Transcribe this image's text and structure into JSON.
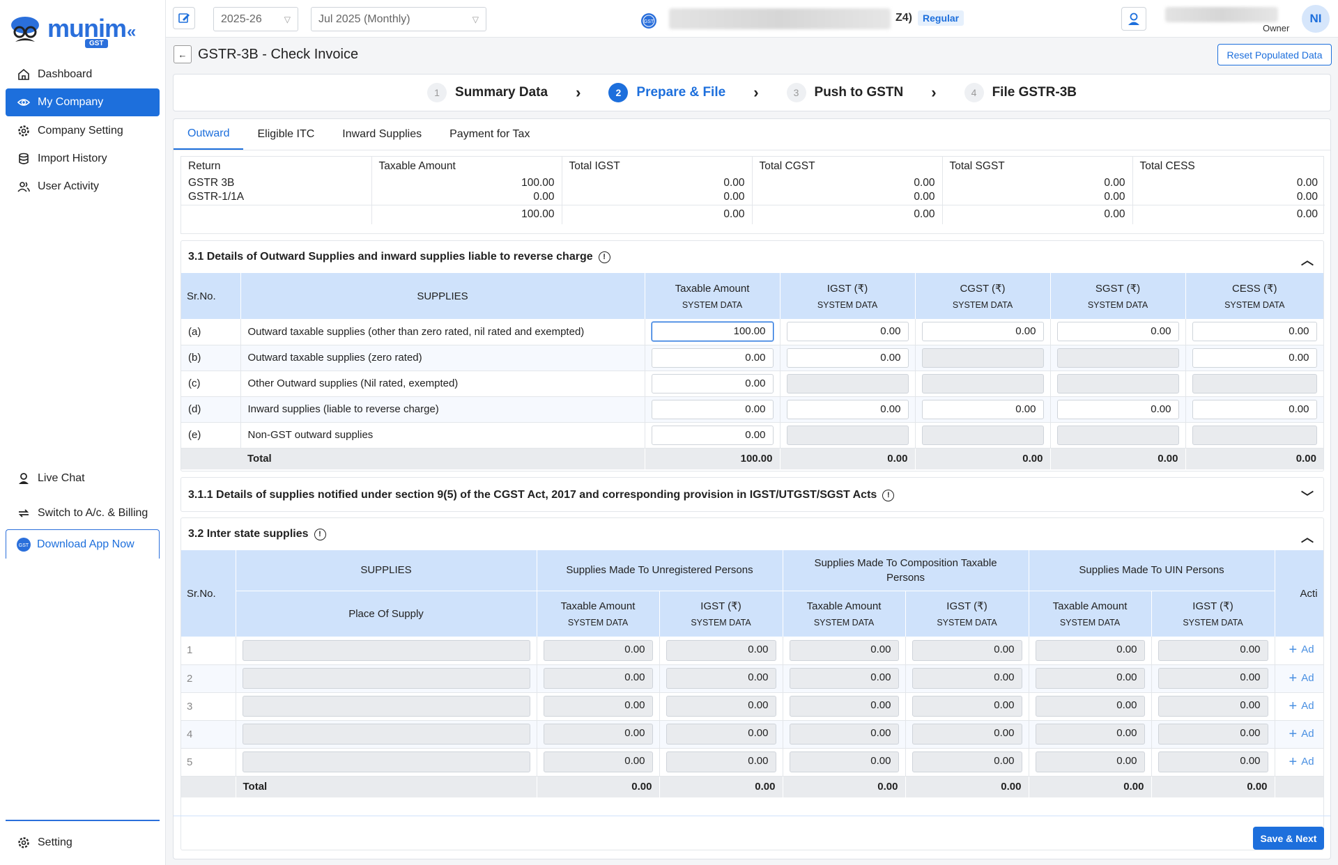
{
  "app": {
    "logo": "munim",
    "logo_sub": "GST",
    "collapse": "«"
  },
  "sidebar": {
    "items": [
      {
        "label": "Dashboard"
      },
      {
        "label": "My Company"
      },
      {
        "label": "Company Setting"
      },
      {
        "label": "Import History"
      },
      {
        "label": "User Activity"
      }
    ],
    "bottom": {
      "live_chat": "Live Chat",
      "switch": "Switch to A/c. & Billing",
      "download": "Download App Now",
      "setting": "Setting"
    }
  },
  "topbar": {
    "year": "2025-26",
    "period": "Jul 2025 (Monthly)",
    "gstin_suffix": "Z4)",
    "type_badge": "Regular",
    "role": "Owner",
    "avatar": "NI"
  },
  "page": {
    "back": "←",
    "title": "GSTR-3B - Check Invoice",
    "reset": "Reset Populated Data"
  },
  "steps": [
    {
      "num": "1",
      "label": "Summary Data",
      "state": "done"
    },
    {
      "num": "2",
      "label": "Prepare & File",
      "state": "active"
    },
    {
      "num": "3",
      "label": "Push to GSTN",
      "state": "pending"
    },
    {
      "num": "4",
      "label": "File GSTR-3B",
      "state": "pending"
    }
  ],
  "step_sep": "›",
  "tabs": [
    "Outward",
    "Eligible ITC",
    "Inward Supplies",
    "Payment for Tax"
  ],
  "summary": {
    "headers": [
      "Return",
      "Taxable Amount",
      "Total IGST",
      "Total CGST",
      "Total SGST",
      "Total CESS"
    ],
    "rows": [
      [
        "GSTR 3B",
        "100.00",
        "0.00",
        "0.00",
        "0.00",
        "0.00"
      ],
      [
        "GSTR-1/1A",
        "0.00",
        "0.00",
        "0.00",
        "0.00",
        "0.00"
      ],
      [
        "",
        "100.00",
        "0.00",
        "0.00",
        "0.00",
        "0.00"
      ]
    ]
  },
  "s31": {
    "title": "3.1 Details of Outward Supplies and inward supplies liable to reverse charge",
    "col_sr": "Sr.No.",
    "col_supplies": "SUPPLIES",
    "cols": [
      "Taxable Amount",
      "IGST (₹)",
      "CGST (₹)",
      "SGST (₹)",
      "CESS (₹)"
    ],
    "sub": "SYSTEM DATA",
    "rows": [
      {
        "sr": "(a)",
        "label": "Outward taxable supplies (other than zero rated, nil rated and exempted)",
        "vals": [
          "100.00",
          "0.00",
          "0.00",
          "0.00",
          "0.00"
        ]
      },
      {
        "sr": "(b)",
        "label": "Outward taxable supplies (zero rated)",
        "vals": [
          "0.00",
          "0.00",
          "",
          "",
          "0.00"
        ]
      },
      {
        "sr": "(c)",
        "label": "Other Outward supplies (Nil rated, exempted)",
        "vals": [
          "0.00",
          "",
          "",
          "",
          ""
        ]
      },
      {
        "sr": "(d)",
        "label": "Inward supplies (liable to reverse charge)",
        "vals": [
          "0.00",
          "0.00",
          "0.00",
          "0.00",
          "0.00"
        ]
      },
      {
        "sr": "(e)",
        "label": "Non-GST outward supplies",
        "vals": [
          "0.00",
          "",
          "",
          "",
          ""
        ]
      }
    ],
    "total_label": "Total",
    "totals": [
      "100.00",
      "0.00",
      "0.00",
      "0.00",
      "0.00"
    ]
  },
  "s311": {
    "title": "3.1.1 Details of supplies notified under section 9(5) of the CGST Act, 2017 and corresponding provision in IGST/UTGST/SGST Acts"
  },
  "s32": {
    "title": "3.2 Inter state supplies",
    "col_sr": "Sr.No.",
    "col_supplies": "SUPPLIES",
    "col_pos": "Place Of Supply",
    "groups": [
      "Supplies Made To Unregistered Persons",
      "Supplies Made To Composition Taxable Persons",
      "Supplies Made To UIN Persons"
    ],
    "sub_taxable": "Taxable Amount",
    "sub_igst": "IGST (₹)",
    "sub": "SYSTEM DATA",
    "col_action": "Acti",
    "add_label": "Ad",
    "rows": [
      {
        "sr": "1",
        "vals": [
          "0.00",
          "0.00",
          "0.00",
          "0.00",
          "0.00",
          "0.00"
        ]
      },
      {
        "sr": "2",
        "vals": [
          "0.00",
          "0.00",
          "0.00",
          "0.00",
          "0.00",
          "0.00"
        ]
      },
      {
        "sr": "3",
        "vals": [
          "0.00",
          "0.00",
          "0.00",
          "0.00",
          "0.00",
          "0.00"
        ]
      },
      {
        "sr": "4",
        "vals": [
          "0.00",
          "0.00",
          "0.00",
          "0.00",
          "0.00",
          "0.00"
        ]
      },
      {
        "sr": "5",
        "vals": [
          "0.00",
          "0.00",
          "0.00",
          "0.00",
          "0.00",
          "0.00"
        ]
      }
    ],
    "total_label": "Total",
    "totals": [
      "0.00",
      "0.00",
      "0.00",
      "0.00",
      "0.00",
      "0.00"
    ]
  },
  "footer": {
    "save": "Save & Next"
  },
  "colors": {
    "primary": "#1d6fdc",
    "header_blue": "#cfe2fb"
  }
}
